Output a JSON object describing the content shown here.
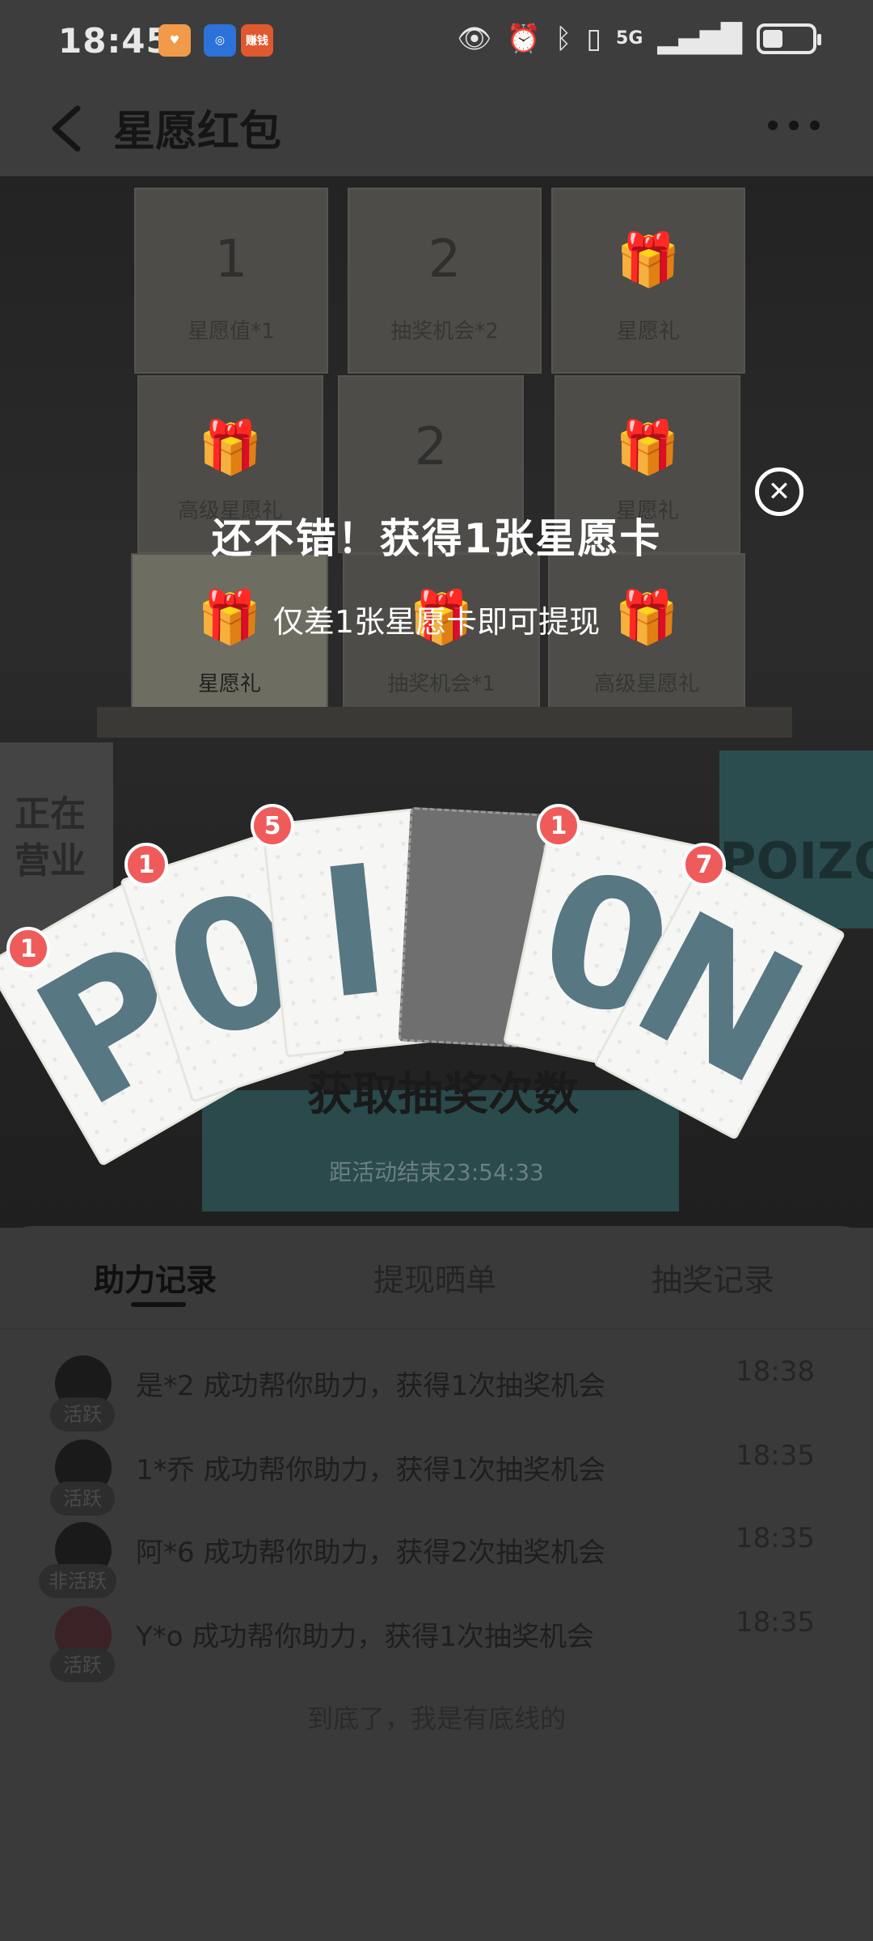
{
  "status": {
    "time": "18:45",
    "apps": [
      "heart-app-icon",
      "browser-app-icon",
      "money-app-icon"
    ],
    "money_app_label": "赚钱",
    "network": "5G"
  },
  "nav": {
    "title": "星愿红包"
  },
  "hero": {
    "boxes": [
      {
        "label": "星愿值*1",
        "glyph": "1"
      },
      {
        "label": "抽奖机会*2",
        "glyph": "2"
      },
      {
        "label": "星愿礼",
        "glyph": "🎁"
      },
      {
        "label": "高级星愿礼",
        "glyph": "🎁"
      },
      {
        "label": "",
        "glyph": "2"
      },
      {
        "label": "星愿礼",
        "glyph": "🎁"
      },
      {
        "label": "星愿礼",
        "glyph": "🎁"
      },
      {
        "label": "抽奖机会*1",
        "glyph": "🎁"
      },
      {
        "label": "高级星愿礼",
        "glyph": "🎁"
      }
    ],
    "store_sign": "正在营业",
    "teal_box_text": "POIZON",
    "dark_word": "获取抽奖次数",
    "countdown": "距活动结束23:54:33"
  },
  "popup": {
    "title": "还不错！获得1张星愿卡",
    "subtitle": "仅差1张星愿卡即可提现"
  },
  "cards": [
    {
      "letter": "P",
      "count": "1"
    },
    {
      "letter": "0",
      "count": "1"
    },
    {
      "letter": "I",
      "count": "5"
    },
    {
      "letter": "",
      "count": ""
    },
    {
      "letter": "0",
      "count": "1"
    },
    {
      "letter": "N",
      "count": "7"
    }
  ],
  "sheet": {
    "tabs": [
      "助力记录",
      "提现晒单",
      "抽奖记录"
    ],
    "active_tab": "助力记录",
    "records": [
      {
        "text": "是*2 成功帮你助力，获得1次抽奖机会",
        "time": "18:38",
        "tag": "活跃"
      },
      {
        "text": "1*乔 成功帮你助力，获得1次抽奖机会",
        "time": "18:35",
        "tag": "活跃"
      },
      {
        "text": "阿*6 成功帮你助力，获得2次抽奖机会",
        "time": "18:35",
        "tag": "非活跃"
      },
      {
        "text": "Y*o 成功帮你助力，获得1次抽奖机会",
        "time": "18:35",
        "tag": "活跃"
      }
    ],
    "footer": "到底了，我是有底线的"
  }
}
